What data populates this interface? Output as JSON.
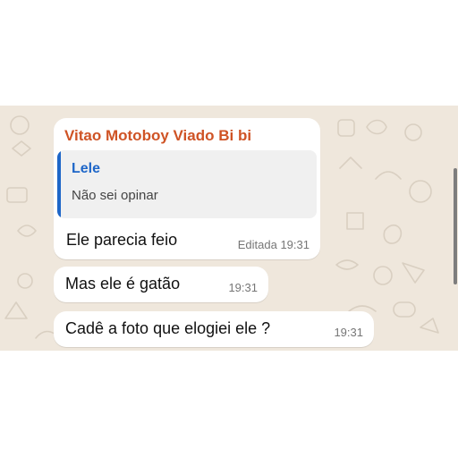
{
  "colors": {
    "wallpaper": "#efe7dc",
    "bubble": "#ffffff",
    "sender_name": "#cf5325",
    "quote_accent": "#1e66c8",
    "quote_background": "#f0f0f0",
    "timestamp": "#767676"
  },
  "messages": [
    {
      "sender": "Vitao Motoboy Viado Bi bi",
      "quoted": {
        "author": "Lele",
        "text": "Não sei opinar"
      },
      "text": "Ele parecia feio",
      "edited_label": "Editada",
      "time": "19:31"
    },
    {
      "text": "Mas ele é gatão",
      "time": "19:31"
    },
    {
      "text": "Cadê a foto que elogiei ele ?",
      "time": "19:31"
    }
  ]
}
